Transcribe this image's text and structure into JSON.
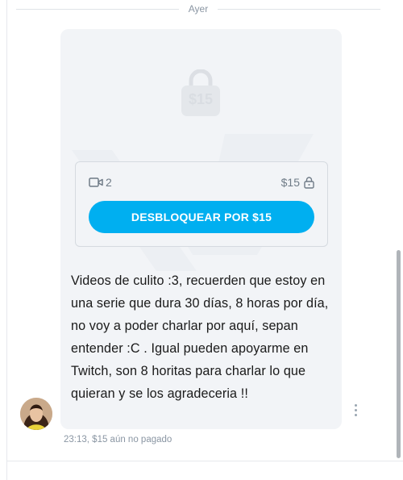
{
  "chat": {
    "day_divider": "Ayer",
    "message": {
      "locked_preview_price": "$15",
      "media_count": "2",
      "price": "$15",
      "unlock_button_label": "DESBLOQUEAR POR $15",
      "text": "Videos de culito :3, recuerden que estoy en una serie que dura 30 días, 8 horas por día, no voy a poder charlar por aquí, sepan entender :C . Igual pueden apoyarme en Twitch, son 8 horitas para charlar lo que quieran y se los agradeceria !!",
      "time": "23:13",
      "payment_status": ", $15 aún no pagado"
    }
  },
  "icons": {
    "lock_preview": "lock-icon",
    "media": "video-icon",
    "price_lock": "lock-icon",
    "more": "more-vertical-icon"
  },
  "colors": {
    "accent": "#00aff0",
    "bubble_bg": "#f2f4f7",
    "muted_text": "#8a96a3"
  }
}
